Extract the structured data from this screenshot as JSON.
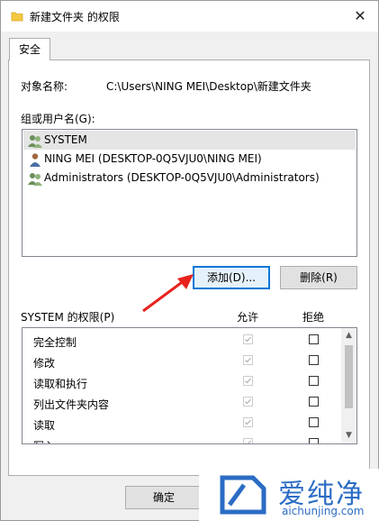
{
  "window": {
    "title": "新建文件夹 的权限",
    "close_symbol": "✕",
    "title_icon": "folder-icon"
  },
  "tabs": [
    {
      "label": "安全",
      "selected": true
    }
  ],
  "object": {
    "label": "对象名称:",
    "value": "C:\\Users\\NING MEI\\Desktop\\新建文件夹"
  },
  "groups": {
    "label": "组或用户名(G):",
    "items": [
      {
        "name": "SYSTEM",
        "icon": "user-group-icon",
        "selected": true
      },
      {
        "name": "NING MEI (DESKTOP-0Q5VJU0\\NING MEI)",
        "icon": "user-icon",
        "selected": false
      },
      {
        "name": "Administrators (DESKTOP-0Q5VJU0\\Administrators)",
        "icon": "user-group-icon",
        "selected": false
      }
    ]
  },
  "buttons": {
    "add": "添加(D)...",
    "remove": "删除(R)",
    "ok": "确定"
  },
  "permissions": {
    "label": "SYSTEM 的权限(P)",
    "allow_header": "允许",
    "deny_header": "拒绝",
    "items": [
      {
        "name": "完全控制",
        "allow": true,
        "deny": false
      },
      {
        "name": "修改",
        "allow": true,
        "deny": false
      },
      {
        "name": "读取和执行",
        "allow": true,
        "deny": false
      },
      {
        "name": "列出文件夹内容",
        "allow": true,
        "deny": false
      },
      {
        "name": "读取",
        "allow": true,
        "deny": false
      },
      {
        "name": "写入",
        "allow": true,
        "deny": false
      }
    ]
  },
  "watermark": {
    "brand": "爱纯净",
    "url": "aichunjing.com"
  },
  "colors": {
    "accent": "#0078d7",
    "arrow": "#e8231c",
    "watermark": "#2b6cc4",
    "selection": "#e5e5e5"
  }
}
